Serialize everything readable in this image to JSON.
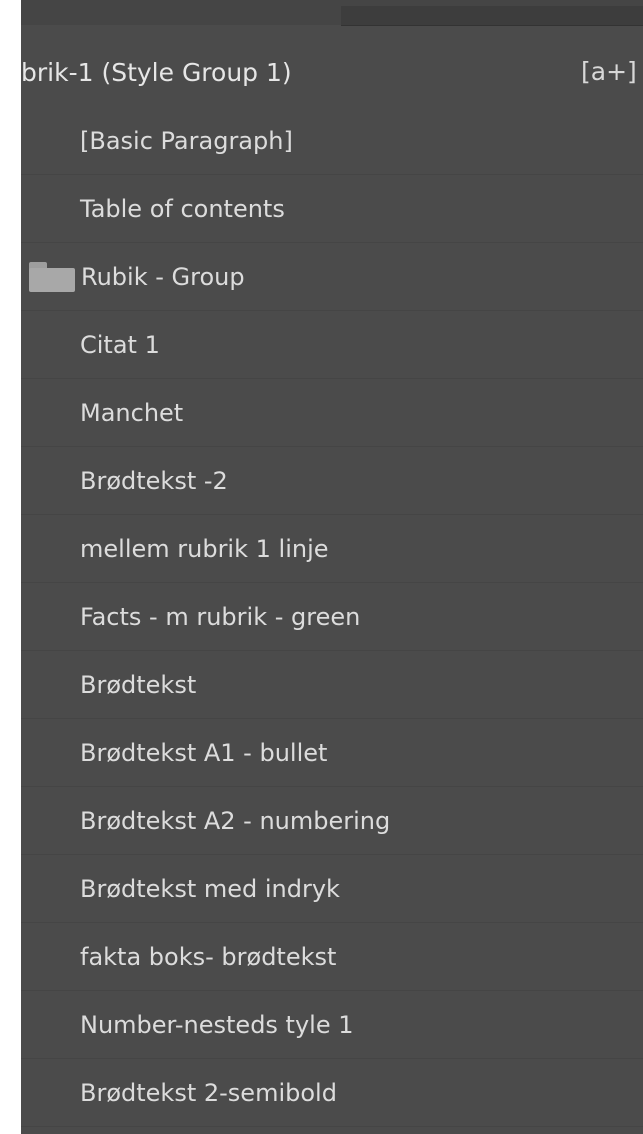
{
  "panel": {
    "header": {
      "title": "brik-1 (Style Group 1)",
      "new_style_icon_glyph": "[a+]"
    },
    "items": [
      {
        "label": "[Basic Paragraph]",
        "type": "style"
      },
      {
        "label": "Table of contents",
        "type": "style"
      },
      {
        "label": "Rubik - Group",
        "type": "group",
        "icon": "folder-icon"
      },
      {
        "label": "Citat 1",
        "type": "style"
      },
      {
        "label": "Manchet",
        "type": "style"
      },
      {
        "label": "Brødtekst -2",
        "type": "style"
      },
      {
        "label": "mellem rubrik 1 linje",
        "type": "style"
      },
      {
        "label": "Facts - m rubrik - green",
        "type": "style"
      },
      {
        "label": "Brødtekst",
        "type": "style"
      },
      {
        "label": "Brødtekst A1 - bullet",
        "type": "style"
      },
      {
        "label": "Brødtekst A2 - numbering",
        "type": "style"
      },
      {
        "label": "Brødtekst med indryk",
        "type": "style"
      },
      {
        "label": "fakta boks- brødtekst",
        "type": "style"
      },
      {
        "label": "Number-nesteds tyle 1",
        "type": "style"
      },
      {
        "label": "Brødtekst 2-semibold",
        "type": "style"
      }
    ]
  },
  "colors": {
    "panel_bg": "#4b4b4b",
    "text": "#dcdcdc",
    "folder": "#a8a8a8"
  }
}
